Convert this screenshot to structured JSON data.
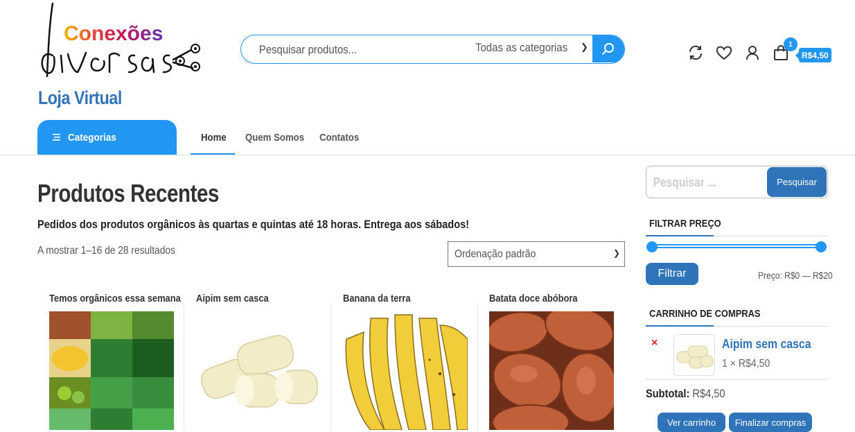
{
  "header": {
    "logo_text": "Conexões",
    "tagline": "Loja Virtual",
    "search": {
      "placeholder": "Pesquisar produtos...",
      "category": "Todas as categorias"
    },
    "cart": {
      "count": "1",
      "total": "R$4,50"
    }
  },
  "nav": {
    "categories_label": "Categorias",
    "links": [
      "Home",
      "Quem Somos",
      "Contatos"
    ]
  },
  "main": {
    "title": "Produtos Recentes",
    "notice": "Pedidos dos produtos orgânicos às quartas e quintas até 18 horas. Entrega aos sábados!",
    "result_count": "A mostrar 1–16 de 28 resultados",
    "orderby": "Ordenação padrão",
    "products": [
      {
        "name": "Temos orgânicos essa semana"
      },
      {
        "name": "Aipim sem casca"
      },
      {
        "name": "Banana da terra"
      },
      {
        "name": "Batata doce abóbora"
      }
    ]
  },
  "sidebar": {
    "search": {
      "placeholder": "Pesquisar ...",
      "button": "Pesquisar"
    },
    "price_filter": {
      "title": "FILTRAR PREÇO",
      "button": "Filtrar",
      "range_text": "Preço: R$0 — R$20",
      "min": 0,
      "max": 20
    },
    "cart": {
      "title": "CARRINHO DE COMPRAS",
      "remove": "×",
      "item_name": "Aipim sem casca",
      "item_qty": "1 × R$4,50",
      "subtotal_label": "Subtotal:",
      "subtotal_value": "R$4,50",
      "view_cart": "Ver carrinho",
      "checkout": "Finalizar compras"
    }
  },
  "colors": {
    "accent": "#2196f3",
    "brand_blue": "#2f73b8",
    "remove_red": "#e02020"
  }
}
